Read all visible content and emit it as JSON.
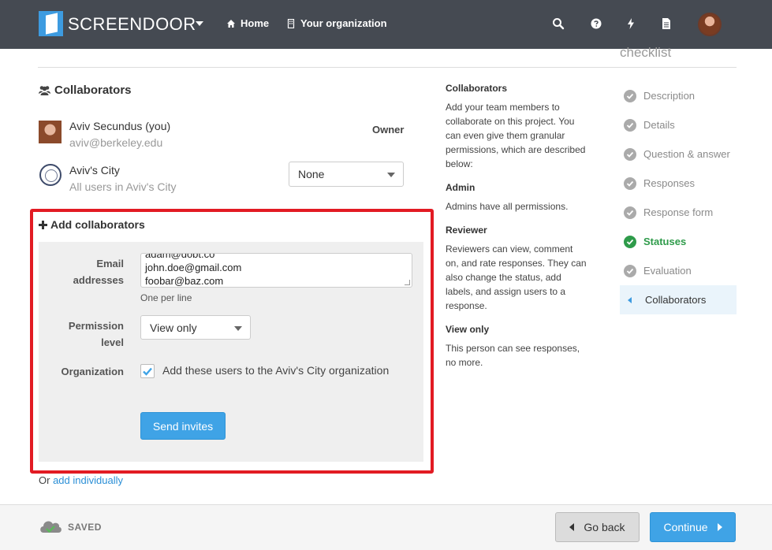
{
  "nav": {
    "brand": "SCREENDOOR",
    "home": "Home",
    "organization": "Your organization"
  },
  "checklist": {
    "heading": "checklist",
    "items": [
      {
        "label": "Description",
        "state": "done"
      },
      {
        "label": "Details",
        "state": "done"
      },
      {
        "label": "Question & answer",
        "state": "done"
      },
      {
        "label": "Responses",
        "state": "done"
      },
      {
        "label": "Response form",
        "state": "done"
      },
      {
        "label": "Statuses",
        "state": "done-green"
      },
      {
        "label": "Evaluation",
        "state": "done"
      },
      {
        "label": "Collaborators",
        "state": "active"
      }
    ]
  },
  "collaborators": {
    "title": "Collaborators",
    "owner": {
      "name": "Aviv Secundus (you)",
      "email": "aviv@berkeley.edu",
      "role": "Owner"
    },
    "org": {
      "name": "Aviv's City",
      "sub": "All users in Aviv's City",
      "permission": "None"
    }
  },
  "add": {
    "title": "Add collaborators",
    "email_label_1": "Email",
    "email_label_2": "addresses",
    "emails": [
      "adam@dobt.co",
      "john.doe@gmail.com",
      "foobar@baz.com"
    ],
    "help": "One per line",
    "permission_label_1": "Permission",
    "permission_label_2": "level",
    "permission_value": "View only",
    "org_label": "Organization",
    "org_checkbox": "Add these users to the Aviv's City organization",
    "org_checked": true,
    "send": "Send invites",
    "or_text": "Or",
    "individually": "add individually"
  },
  "help": {
    "title": "Collaborators",
    "intro": "Add your team members to collaborate on this project. You can even give them granular permissions, which are described below:",
    "admin_title": "Admin",
    "admin_text": "Admins have all permissions.",
    "reviewer_title": "Reviewer",
    "reviewer_text": "Reviewers can view, comment on, and rate responses. They can also change the status, add labels, and assign users to a response.",
    "view_title": "View only",
    "view_text": "This person can see responses, no more."
  },
  "footer": {
    "saved": "SAVED",
    "back": "Go back",
    "continue": "Continue"
  },
  "colors": {
    "accent": "#3fa3e6",
    "highlight": "#e21b23",
    "nav_bg": "#454a52",
    "success": "#2e9b4a"
  }
}
